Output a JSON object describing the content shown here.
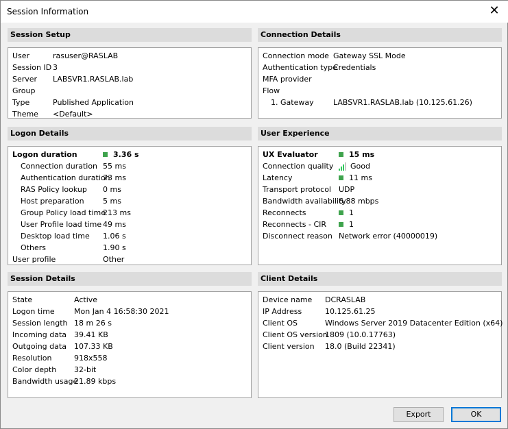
{
  "window": {
    "title": "Session Information",
    "close_icon": "close-icon"
  },
  "colors": {
    "indicator_good": "#3fa34d",
    "accent": "#0078d7"
  },
  "panels": [
    {
      "id": "session-setup",
      "title": "Session Setup",
      "rows": [
        {
          "label": "User",
          "value": "rasuser@RASLAB"
        },
        {
          "label": "Session ID",
          "value": "3"
        },
        {
          "label": "Server",
          "value": "LABSVR1.RASLAB.lab"
        },
        {
          "label": "Group",
          "value": ""
        },
        {
          "label": "Type",
          "value": "Published Application"
        },
        {
          "label": "Theme",
          "value": "<Default>"
        }
      ]
    },
    {
      "id": "connection-details",
      "title": "Connection Details",
      "rows": [
        {
          "label": "Connection mode",
          "value": "Gateway SSL Mode"
        },
        {
          "label": "Authentication type",
          "value": "Credentials"
        },
        {
          "label": "MFA provider",
          "value": ""
        },
        {
          "label": "Flow",
          "value": ""
        },
        {
          "label": "1. Gateway",
          "value": "LABSVR1.RASLAB.lab (10.125.61.26)",
          "indent": true
        }
      ]
    },
    {
      "id": "logon-details",
      "title": "Logon Details",
      "rows": [
        {
          "label": "Logon duration",
          "value": "3.36 s",
          "bold": true,
          "indicator": "good"
        },
        {
          "label": "Connection duration",
          "value": "55 ms",
          "indent": true
        },
        {
          "label": "Authentication duration",
          "value": "73 ms",
          "indent": true
        },
        {
          "label": "RAS Policy lookup",
          "value": "0 ms",
          "indent": true
        },
        {
          "label": "Host preparation",
          "value": "5 ms",
          "indent": true
        },
        {
          "label": "Group Policy load time",
          "value": "213 ms",
          "indent": true
        },
        {
          "label": "User Profile load time",
          "value": "49 ms",
          "indent": true
        },
        {
          "label": "Desktop load time",
          "value": "1.06 s",
          "indent": true
        },
        {
          "label": "Others",
          "value": "1.90 s",
          "indent": true
        },
        {
          "label": "User profile",
          "value": "Other"
        }
      ]
    },
    {
      "id": "user-experience",
      "title": "User Experience",
      "rows": [
        {
          "label": "UX Evaluator",
          "value": "15 ms",
          "bold": true,
          "indicator": "good"
        },
        {
          "label": "Connection quality",
          "value": "Good",
          "signal_bars": 3,
          "signal_max": 4
        },
        {
          "label": "Latency",
          "value": "11 ms",
          "indicator": "good"
        },
        {
          "label": "Transport protocol",
          "value": "UDP"
        },
        {
          "label": "Bandwidth availability",
          "value": "6.88 mbps"
        },
        {
          "label": "Reconnects",
          "value": "1",
          "indicator": "good"
        },
        {
          "label": "Reconnects - CIR",
          "value": "1",
          "indicator": "good"
        },
        {
          "label": "Disconnect reason",
          "value": "Network error (40000019)"
        }
      ]
    },
    {
      "id": "session-details",
      "title": "Session Details",
      "rows": [
        {
          "label": "State",
          "value": "Active"
        },
        {
          "label": "Logon time",
          "value": "Mon Jan  4 16:58:30 2021"
        },
        {
          "label": "Session length",
          "value": "18 m 26 s"
        },
        {
          "label": "Incoming data",
          "value": "39.41 KB"
        },
        {
          "label": "Outgoing data",
          "value": "107.33 KB"
        },
        {
          "label": "Resolution",
          "value": "918x558"
        },
        {
          "label": "Color depth",
          "value": "32-bit"
        },
        {
          "label": "Bandwidth usage",
          "value": "21.89 kbps"
        }
      ]
    },
    {
      "id": "client-details",
      "title": "Client Details",
      "rows": [
        {
          "label": "Device name",
          "value": "DCRASLAB"
        },
        {
          "label": "IP Address",
          "value": "10.125.61.25"
        },
        {
          "label": "Client OS",
          "value": "Windows Server 2019 Datacenter Edition (x64)"
        },
        {
          "label": "Client OS version",
          "value": "1809 (10.0.17763)"
        },
        {
          "label": "Client version",
          "value": "18.0 (Build 22341)"
        }
      ]
    }
  ],
  "buttons": {
    "export": "Export",
    "ok": "OK"
  }
}
